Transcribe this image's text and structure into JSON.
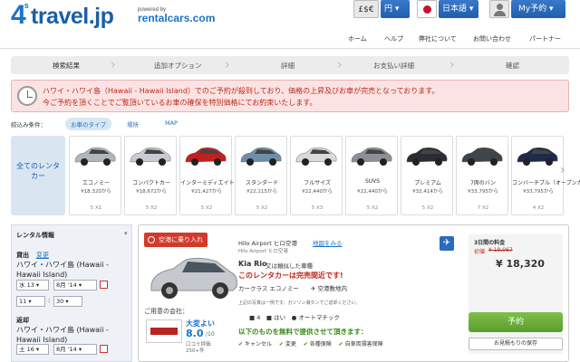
{
  "brand": {
    "logo_num": "4",
    "logo_sup": "s",
    "logo_text": "travel.jp",
    "powered_by": "powered by",
    "partner": "rentalcars.com"
  },
  "top_controls": {
    "currency_icon": "£$€",
    "currency": "円",
    "language": "日本語",
    "my_booking": "My予約"
  },
  "nav": [
    "ホーム",
    "ヘルプ",
    "弊社について",
    "お問い合わせ",
    "パートナー"
  ],
  "steps": [
    "検索結果",
    "追加オプション",
    "詳細",
    "お支払い詳細",
    "確認"
  ],
  "alert": {
    "line1": "ハワイ・ハワイ島（Hawaii - Hawaii Island）でのご予約が殺到しており、価格の上昇及びお車が完売となっております。",
    "line2": "今ご予約を頂くことでご覧頂いているお車の確保を特別価格にてお約束いたします。"
  },
  "filters": {
    "label": "絞込み条件：",
    "tabs": [
      "お車のタイプ",
      "場所",
      "MAP"
    ]
  },
  "all_types": "全てのレンタカー",
  "car_types": [
    {
      "name": "エコノミー",
      "price": "¥18,320から",
      "spec": "5  X1",
      "color": "#b0b6bd"
    },
    {
      "name": "コンパクトカー",
      "price": "¥18,672から",
      "spec": "5  X2",
      "color": "#c8ccd0"
    },
    {
      "name": "インターミディエイト",
      "price": "¥21,427から",
      "spec": "5  X2",
      "color": "#c21f1f"
    },
    {
      "name": "スタンダード",
      "price": "¥22,115から",
      "spec": "5  X2",
      "color": "#6f8fa8"
    },
    {
      "name": "フルサイズ",
      "price": "¥22,440から",
      "spec": "5  X3",
      "color": "#d8dadc"
    },
    {
      "name": "SUVS",
      "price": "¥22,440から",
      "spec": "5  X2",
      "color": "#8c9096"
    },
    {
      "name": "プレミアム",
      "price": "¥32,414から",
      "spec": "5  X2",
      "color": "#2a2d33"
    },
    {
      "name": "7席のバン",
      "price": "¥33,795から",
      "spec": "7  X2",
      "color": "#3f444b"
    },
    {
      "name": "コンバーチブル（オープンカー）",
      "price": "¥33,795から",
      "spec": "4  X2",
      "color": "#1f2a4a"
    }
  ],
  "rental_info": {
    "title": "レンタル情報",
    "pickup_label": "貸出",
    "change": "変更",
    "pickup_place": "ハワイ・ハワイ島 (Hawaii - Hawaii Island)",
    "pickup_day": "水 13",
    "pickup_month": "8月 '14",
    "pickup_hour": "11",
    "pickup_min": "30",
    "return_label": "返却",
    "return_place": "ハワイ・ハワイ島 (Hawaii - Hawaii Island)",
    "return_day": "土 16",
    "return_month": "8月 '14"
  },
  "result": {
    "ribbon": "空港に乗り入れ",
    "airport": "Hilo Airport ヒロ空港",
    "map_link": "地図をみる",
    "airport_sub": "Hilo Airport ヒロ空港",
    "car_name": "Kia Rio",
    "or_similar": "又は類似した車種",
    "sellout": "このレンタカーは完売間近です!",
    "class": "カークラス エコノミー",
    "counter": "空港敷地内",
    "notice": "上記の写真は一例です。ガソリン満タンでご返却ください。",
    "company_label": "ご用意の会社：",
    "rating_word": "大変よい",
    "rating": "8.0",
    "rating_max": "/10",
    "reviews": "口コミ評価",
    "reviews_count": "250+件",
    "seats": "4",
    "bags": "はい",
    "transmission": "オートマチック",
    "free_label": "以下のものを無料で提供させて頂きます：",
    "free_items": [
      "キャンセル",
      "変更",
      "各種保険",
      "自車両損害保険"
    ],
    "price_label": "3日間の料金",
    "old_price_label": "初値",
    "old_price": "¥ 19,067",
    "price": "¥ 18,320",
    "book": "予約",
    "save": "お見積もりの保存"
  }
}
